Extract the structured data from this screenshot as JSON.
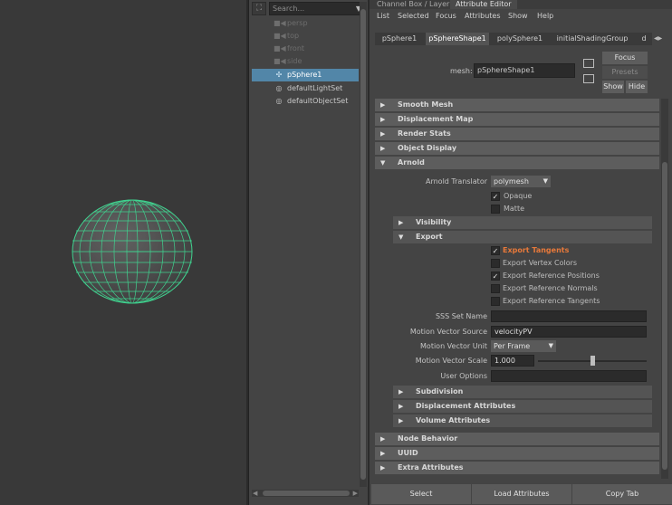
{
  "outliner": {
    "search_placeholder": "Search...",
    "items": [
      {
        "label": "persp",
        "icon": "camera-icon"
      },
      {
        "label": "top",
        "icon": "camera-icon"
      },
      {
        "label": "front",
        "icon": "camera-icon"
      },
      {
        "label": "side",
        "icon": "camera-icon"
      },
      {
        "label": "pSphere1",
        "icon": "transform-icon",
        "selected": true
      },
      {
        "label": "defaultLightSet",
        "icon": "set-icon"
      },
      {
        "label": "defaultObjectSet",
        "icon": "set-icon"
      }
    ]
  },
  "top_tabs": [
    "Channel Box / Layer Editor",
    "Attribute Editor"
  ],
  "menu": [
    "List",
    "Selected",
    "Focus",
    "Attributes",
    "Show",
    "Help"
  ],
  "node_tabs": [
    "pSphere1",
    "pSphereShape1",
    "polySphere1",
    "initialShadingGroup",
    "d"
  ],
  "header": {
    "mesh_label": "mesh:",
    "mesh_value": "pSphereShape1",
    "focus": "Focus",
    "presets": "Presets",
    "show": "Show",
    "hide": "Hide"
  },
  "sections": {
    "smooth_mesh": "Smooth Mesh",
    "displacement_map": "Displacement Map",
    "render_stats": "Render Stats",
    "object_display": "Object Display",
    "arnold": "Arnold",
    "node_behavior": "Node Behavior",
    "uuid": "UUID",
    "extra_attributes": "Extra Attributes"
  },
  "arnold": {
    "translator_label": "Arnold Translator",
    "translator_value": "polymesh",
    "opaque": "Opaque",
    "matte": "Matte",
    "visibility": "Visibility",
    "export": "Export",
    "export_items": [
      {
        "label": "Export Tangents",
        "checked": true,
        "highlight": true
      },
      {
        "label": "Export Vertex Colors",
        "checked": false
      },
      {
        "label": "Export Reference Positions",
        "checked": true
      },
      {
        "label": "Export Reference Normals",
        "checked": false
      },
      {
        "label": "Export Reference Tangents",
        "checked": false
      }
    ],
    "sss_set_name": "SSS Set Name",
    "motion_vector_source": "Motion Vector Source",
    "motion_vector_source_value": "velocityPV",
    "motion_vector_unit": "Motion Vector Unit",
    "motion_vector_unit_value": "Per Frame",
    "motion_vector_scale": "Motion Vector Scale",
    "motion_vector_scale_value": "1.000",
    "motion_vector_scale_fraction": 0.5,
    "user_options": "User Options",
    "subdivision": "Subdivision",
    "displacement_attributes": "Displacement Attributes",
    "volume_attributes": "Volume Attributes"
  },
  "bottom": {
    "select": "Select",
    "load": "Load Attributes",
    "copy": "Copy Tab"
  },
  "colors": {
    "accent": "#5286a8",
    "highlight_text": "#e8793a",
    "wire": "#3fd38f"
  }
}
